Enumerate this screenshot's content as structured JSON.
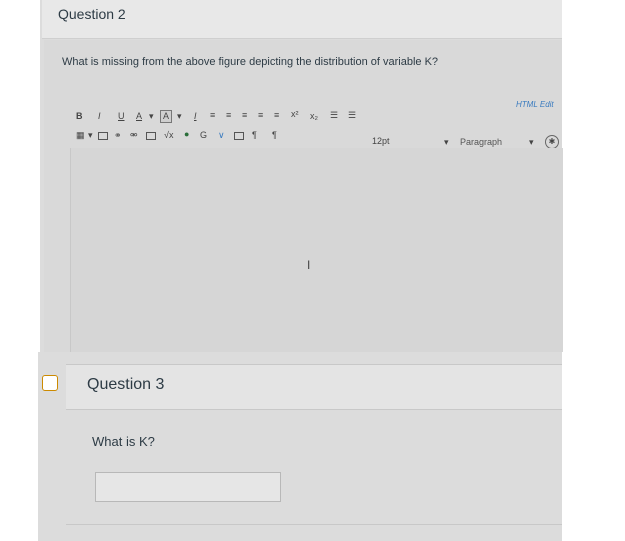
{
  "question2": {
    "title": "Question 2",
    "prompt": "What is missing from the above figure depicting the distribution of variable K?",
    "html_editor_label": "HTML Edit",
    "toolbar": {
      "bold": "B",
      "italic": "I",
      "underline": "U",
      "font_color": "A",
      "highlight": "A",
      "clear_format": "I",
      "font_size": "12pt",
      "paragraph": "Paragraph",
      "superscript": "x²",
      "subscript": "x₂",
      "sqrt": "√x",
      "pilcrow": "¶"
    },
    "cursor_glyph": "I"
  },
  "question3": {
    "title": "Question 3",
    "prompt": "What is K?",
    "answer_value": ""
  }
}
